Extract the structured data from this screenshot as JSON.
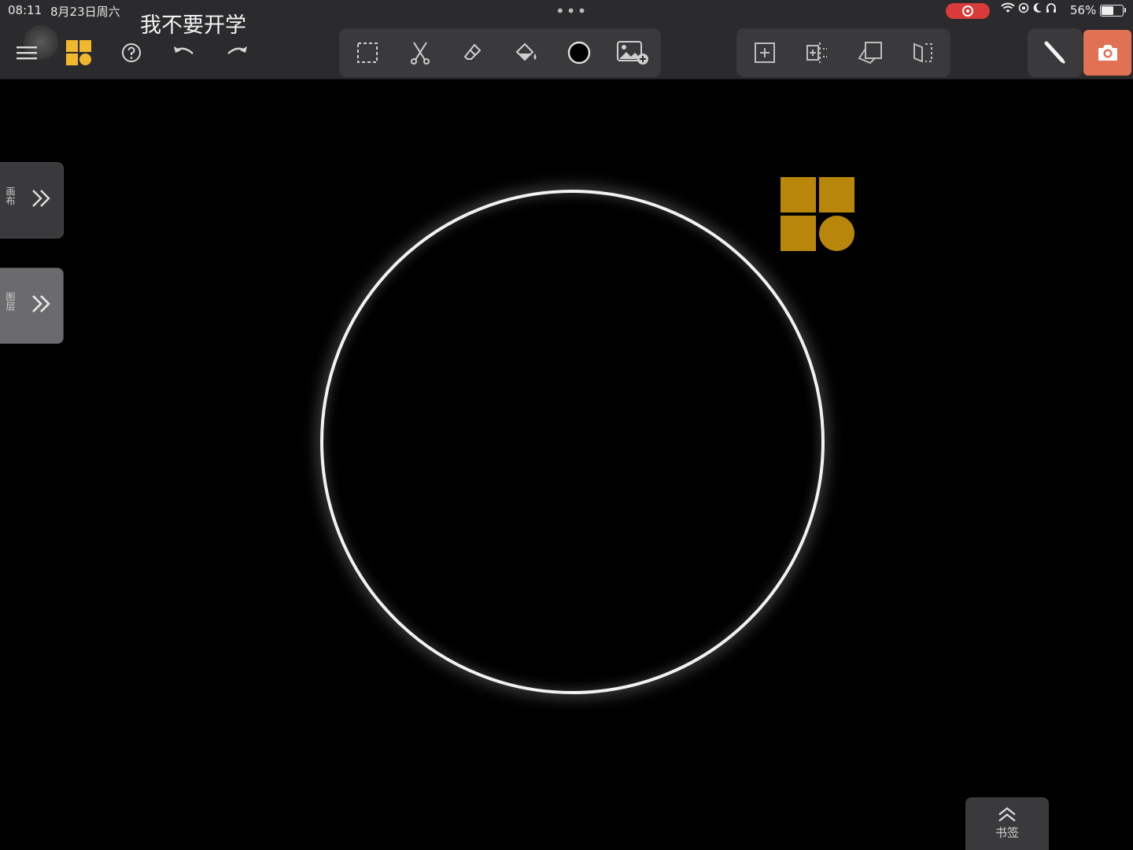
{
  "status": {
    "time": "08:11",
    "date": "8月23日周六",
    "battery": "56%"
  },
  "document": {
    "title": "我不要开学"
  },
  "toolbar": {
    "left": [
      "menu-icon",
      "layout-icon",
      "help-icon",
      "undo-icon",
      "redo-icon"
    ],
    "tools": [
      "lasso-select-icon",
      "scissors-icon",
      "eraser-icon",
      "fill-bucket-icon",
      "shape-icon",
      "insert-image-icon"
    ],
    "pages": [
      "add-page-icon",
      "split-page-icon",
      "copy-page-icon",
      "flip-page-icon"
    ],
    "pen": "pen-icon",
    "camera": "camera-icon"
  },
  "side_panels": [
    {
      "label": "画布"
    },
    {
      "label": "图层"
    }
  ],
  "bookmark": {
    "label": "书签"
  },
  "colors": {
    "accent": "#e07152",
    "logo": "#b8860b",
    "record": "#d93a3a"
  }
}
